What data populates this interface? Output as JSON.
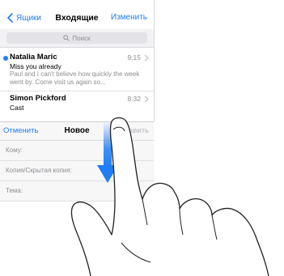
{
  "mail": {
    "back_label": "Ящики",
    "title": "Входящие",
    "edit_label": "Изменить",
    "search_placeholder": "Поиск",
    "messages": [
      {
        "sender": "Natalia Maric",
        "time": "9:15",
        "subject": "Miss you already",
        "preview": "Paul and I can't believe how quickly the week went by. Come visit us again so...",
        "unread": true
      },
      {
        "sender": "Simon Pickford",
        "time": "8:32",
        "subject": "Cast",
        "preview": "",
        "unread": false
      }
    ]
  },
  "compose": {
    "cancel_label": "Отменить",
    "title": "Новое",
    "send_label": "Отправить",
    "to_label": "Кому:",
    "cc_label": "Копия/Скрытая копия:",
    "subject_label": "Тема:"
  },
  "colors": {
    "accent": "#1f7ef6",
    "gesture_arrow": "#1f7ef6",
    "unread_dot": "#1f7ef6"
  },
  "icons": [
    "chevron-left-icon",
    "search-icon",
    "chevron-right-icon",
    "swipe-down-arrow-icon",
    "hand-gesture-icon"
  ]
}
